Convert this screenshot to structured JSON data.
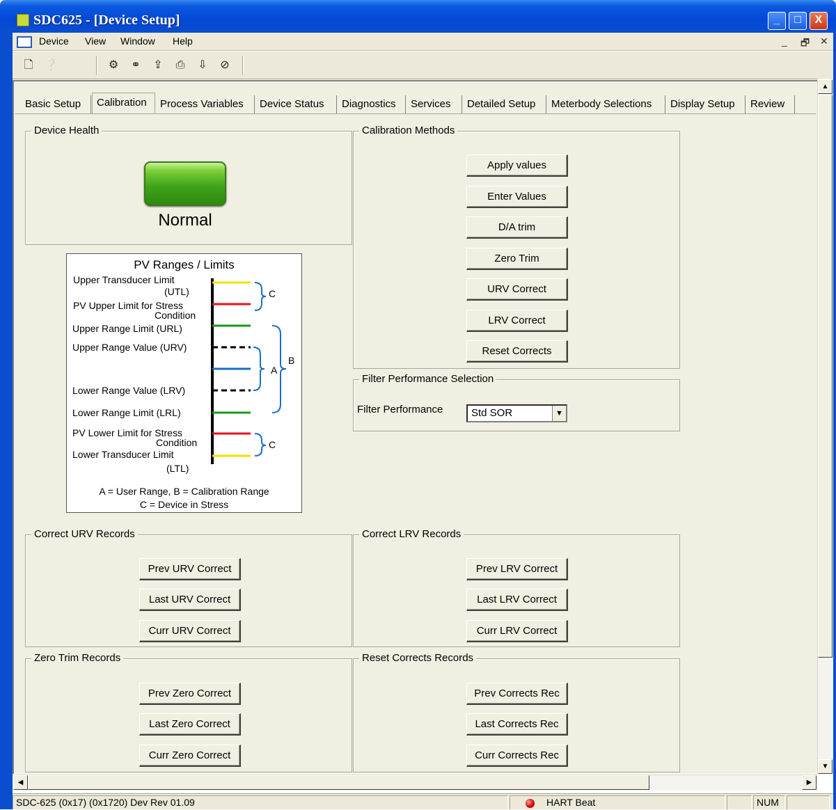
{
  "window": {
    "title": "SDC625 - [Device Setup]",
    "controls": [
      "_",
      "□",
      "X"
    ]
  },
  "menu": {
    "items": [
      "Device",
      "View",
      "Window",
      "Help"
    ],
    "mdi_controls": [
      "_",
      "🗗",
      "✕"
    ]
  },
  "tabs": [
    "Basic Setup",
    "Calibration",
    "Process Variables",
    "Device Status",
    "Diagnostics",
    "Services",
    "Detailed Setup",
    "Meterbody Selections",
    "Display Setup",
    "Review"
  ],
  "active_tab": "Calibration",
  "device_health": {
    "title": "Device Health",
    "status": "Normal",
    "status_color": "#40a51a"
  },
  "pv_ranges": {
    "title": "PV Ranges / Limits",
    "utl": "Upper Transducer Limit",
    "utl_abbr": "(UTL)",
    "pv_upper_stress": "PV Upper Limit for Stress",
    "condition_upper": "Condition",
    "url": "Upper Range Limit (URL)",
    "urv": "Upper Range Value (URV)",
    "lrv": "Lower Range Value (LRV)",
    "lrl": "Lower Range Limit (LRL)",
    "pv_lower_stress": "PV Lower Limit for Stress",
    "condition_lower": "Condition",
    "ltl": "Lower Transducer Limit",
    "ltl_abbr": "(LTL)",
    "label_a": "A",
    "label_b": "B",
    "label_c_top": "C",
    "label_c_bottom": "C",
    "legend_1": "A = User Range, B = Calibration Range",
    "legend_2": "C = Device in Stress",
    "colors": {
      "yellow": "#f2e200",
      "red": "#e8101a",
      "green": "#1a9a1a",
      "blue": "#1a6ec8",
      "black": "#000000"
    }
  },
  "calibration_methods": {
    "title": "Calibration Methods",
    "buttons": [
      "Apply values",
      "Enter Values",
      "D/A trim",
      "Zero Trim",
      "URV Correct",
      "LRV Correct",
      "Reset Corrects"
    ]
  },
  "filter": {
    "title": "Filter Performance Selection",
    "label": "Filter Performance",
    "value": "Std SOR"
  },
  "correct_urv": {
    "title": "Correct URV Records",
    "buttons": [
      "Prev URV Correct",
      "Last URV Correct",
      "Curr URV Correct"
    ]
  },
  "correct_lrv": {
    "title": "Correct LRV Records",
    "buttons": [
      "Prev LRV Correct",
      "Last LRV Correct",
      "Curr LRV Correct"
    ]
  },
  "zero_trim": {
    "title": "Zero Trim Records",
    "buttons": [
      "Prev Zero Correct",
      "Last Zero Correct",
      "Curr Zero Correct"
    ]
  },
  "reset_corrects": {
    "title": "Reset Corrects Records",
    "buttons": [
      "Prev Corrects Rec",
      "Last Corrects Rec",
      "Curr Corrects Rec"
    ]
  },
  "status_bar": {
    "device_info": "SDC-625   (0x17)   (0x1720)   Dev Rev 01.09",
    "hart": "HART Beat",
    "num": "NUM"
  }
}
